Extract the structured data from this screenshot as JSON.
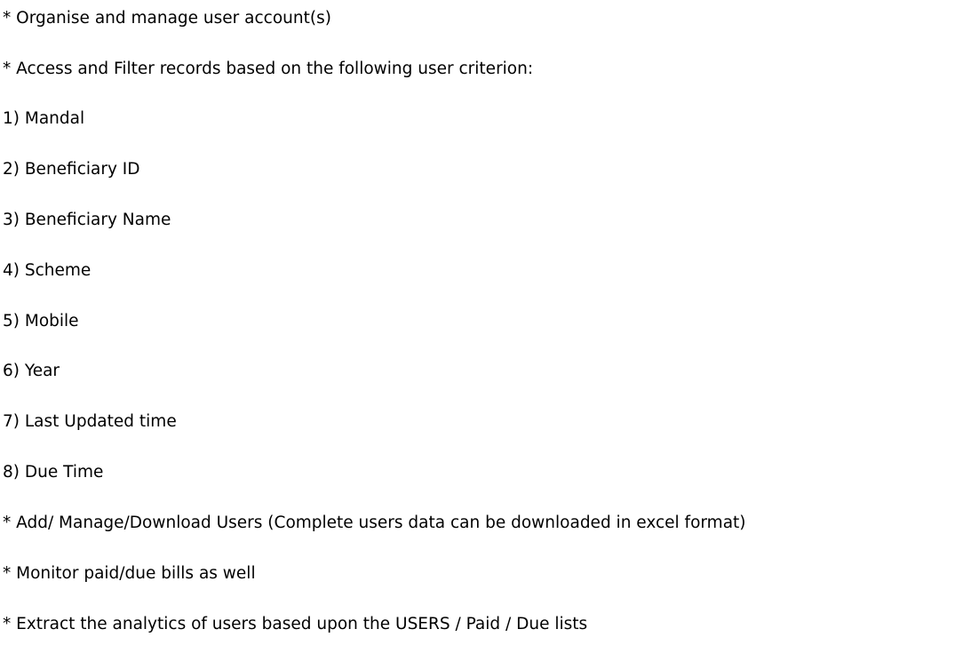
{
  "document": {
    "lines": [
      "* Organise and manage user account(s)",
      "* Access and Filter records based on the following user criterion:",
      "1) Mandal",
      "2) Beneficiary ID",
      "3) Beneficiary Name",
      "4) Scheme",
      "5) Mobile",
      "6) Year",
      "7) Last Updated time",
      "8) Due Time",
      "* Add/ Manage/Download Users (Complete users data can be downloaded in excel format)",
      "* Monitor paid/due bills as well",
      "* Extract the analytics of users based upon the USERS / Paid / Due lists"
    ]
  }
}
